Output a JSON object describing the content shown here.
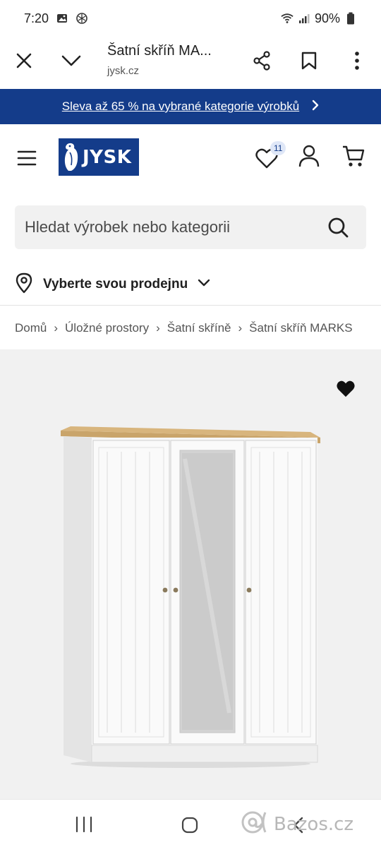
{
  "status_bar": {
    "time": "7:20",
    "battery": "90%",
    "icons": [
      "gallery-icon",
      "openai-icon",
      "wifi-icon",
      "signal-icon",
      "battery-icon"
    ]
  },
  "browser": {
    "title": "Šatní skříň MA...",
    "url": "jysk.cz",
    "icons": [
      "close-icon",
      "chevron-down-icon",
      "share-icon",
      "bookmark-icon",
      "more-icon"
    ]
  },
  "promo": {
    "text": "Sleva až 65 % na vybrané kategorie výrobků",
    "bg_color": "#143c8a"
  },
  "header": {
    "logo_text": "JYSK",
    "wishlist_count": "11",
    "brand_color": "#143c8a"
  },
  "search": {
    "placeholder": "Hledat výrobek nebo kategorii"
  },
  "store": {
    "label": "Vyberte svou prodejnu"
  },
  "breadcrumb": {
    "items": [
      "Domů",
      "Úložné prostory",
      "Šatní skříně",
      "Šatní skříň MARKS"
    ]
  },
  "product": {
    "image_alt_icon": "wardrobe-image"
  },
  "watermark": {
    "text": "Bazos.cz"
  }
}
